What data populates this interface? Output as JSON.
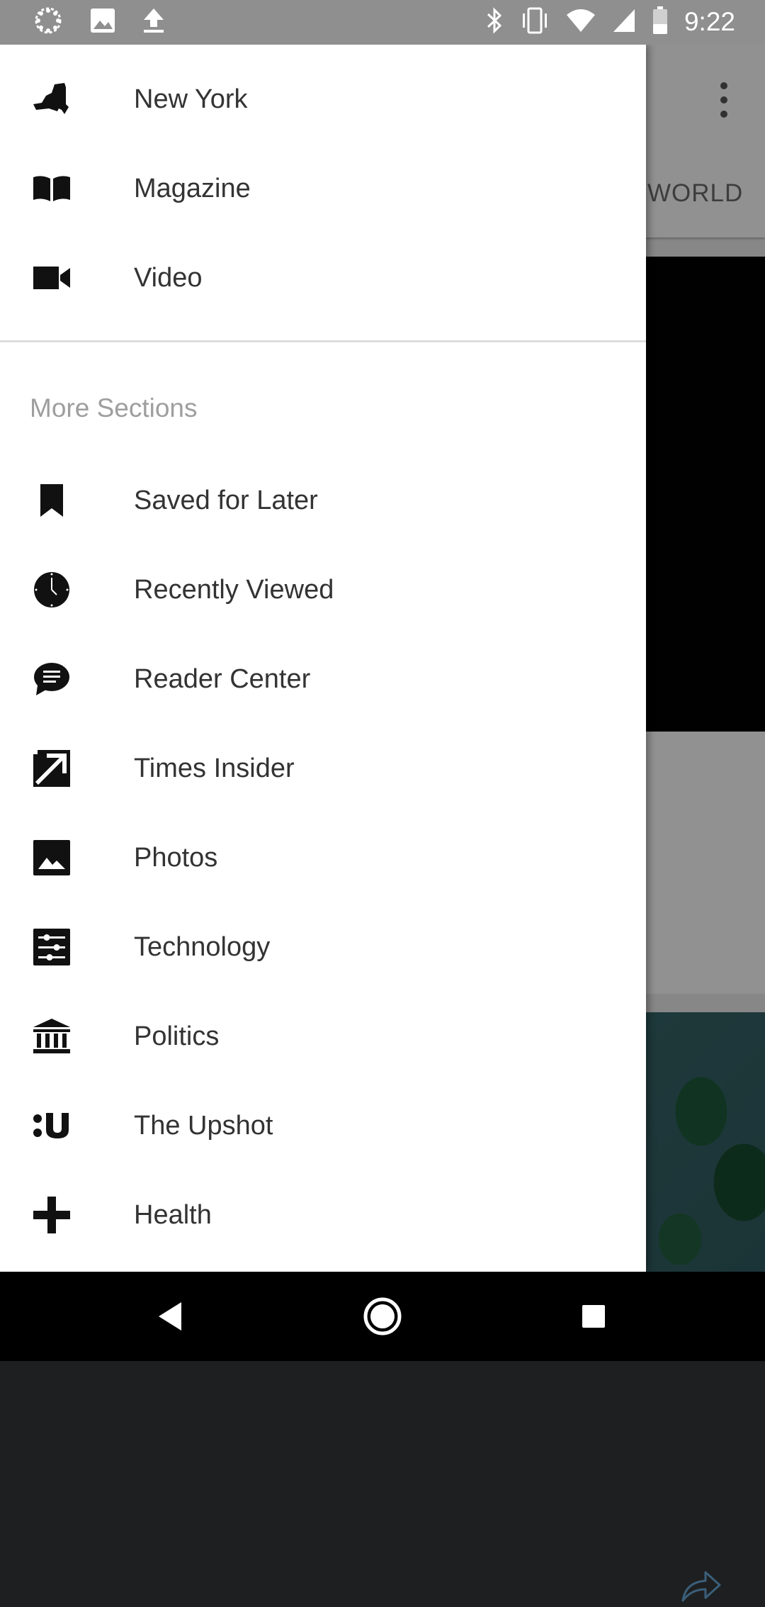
{
  "status_bar": {
    "time": "9:22",
    "left_icons": [
      "canvas-loader-icon",
      "image-icon",
      "upload-icon"
    ],
    "right_icons": [
      "bluetooth-icon",
      "vibrate-icon",
      "wifi-icon",
      "cell-signal-icon",
      "battery-icon"
    ]
  },
  "background_app": {
    "tab_visible": "WORLD",
    "icons": [
      "overflow-menu-icon",
      "share-icon"
    ]
  },
  "drawer": {
    "top_items": [
      {
        "label": "New York",
        "icon": "new-york-state-icon"
      },
      {
        "label": "Magazine",
        "icon": "open-book-icon"
      },
      {
        "label": "Video",
        "icon": "video-camera-icon"
      }
    ],
    "section_header": "More Sections",
    "section_items": [
      {
        "label": "Saved for Later",
        "icon": "bookmark-icon"
      },
      {
        "label": "Recently Viewed",
        "icon": "clock-icon"
      },
      {
        "label": "Reader Center",
        "icon": "chat-bubble-icon"
      },
      {
        "label": "Times Insider",
        "icon": "times-insider-icon"
      },
      {
        "label": "Photos",
        "icon": "photo-icon"
      },
      {
        "label": "Technology",
        "icon": "sliders-icon"
      },
      {
        "label": "Politics",
        "icon": "capitol-building-icon"
      },
      {
        "label": "The Upshot",
        "icon": "upshot-icon"
      },
      {
        "label": "Health",
        "icon": "plus-icon"
      }
    ]
  },
  "navigation_bar": {
    "buttons": [
      "back-icon",
      "home-icon",
      "recents-icon"
    ]
  },
  "colors": {
    "status_bar": "#8f8f8f",
    "drawer_background": "#ffffff",
    "label_text": "#333333",
    "section_header_text": "#9e9e9e",
    "divider": "#dcdcdc",
    "nav_bar": "#000000"
  }
}
